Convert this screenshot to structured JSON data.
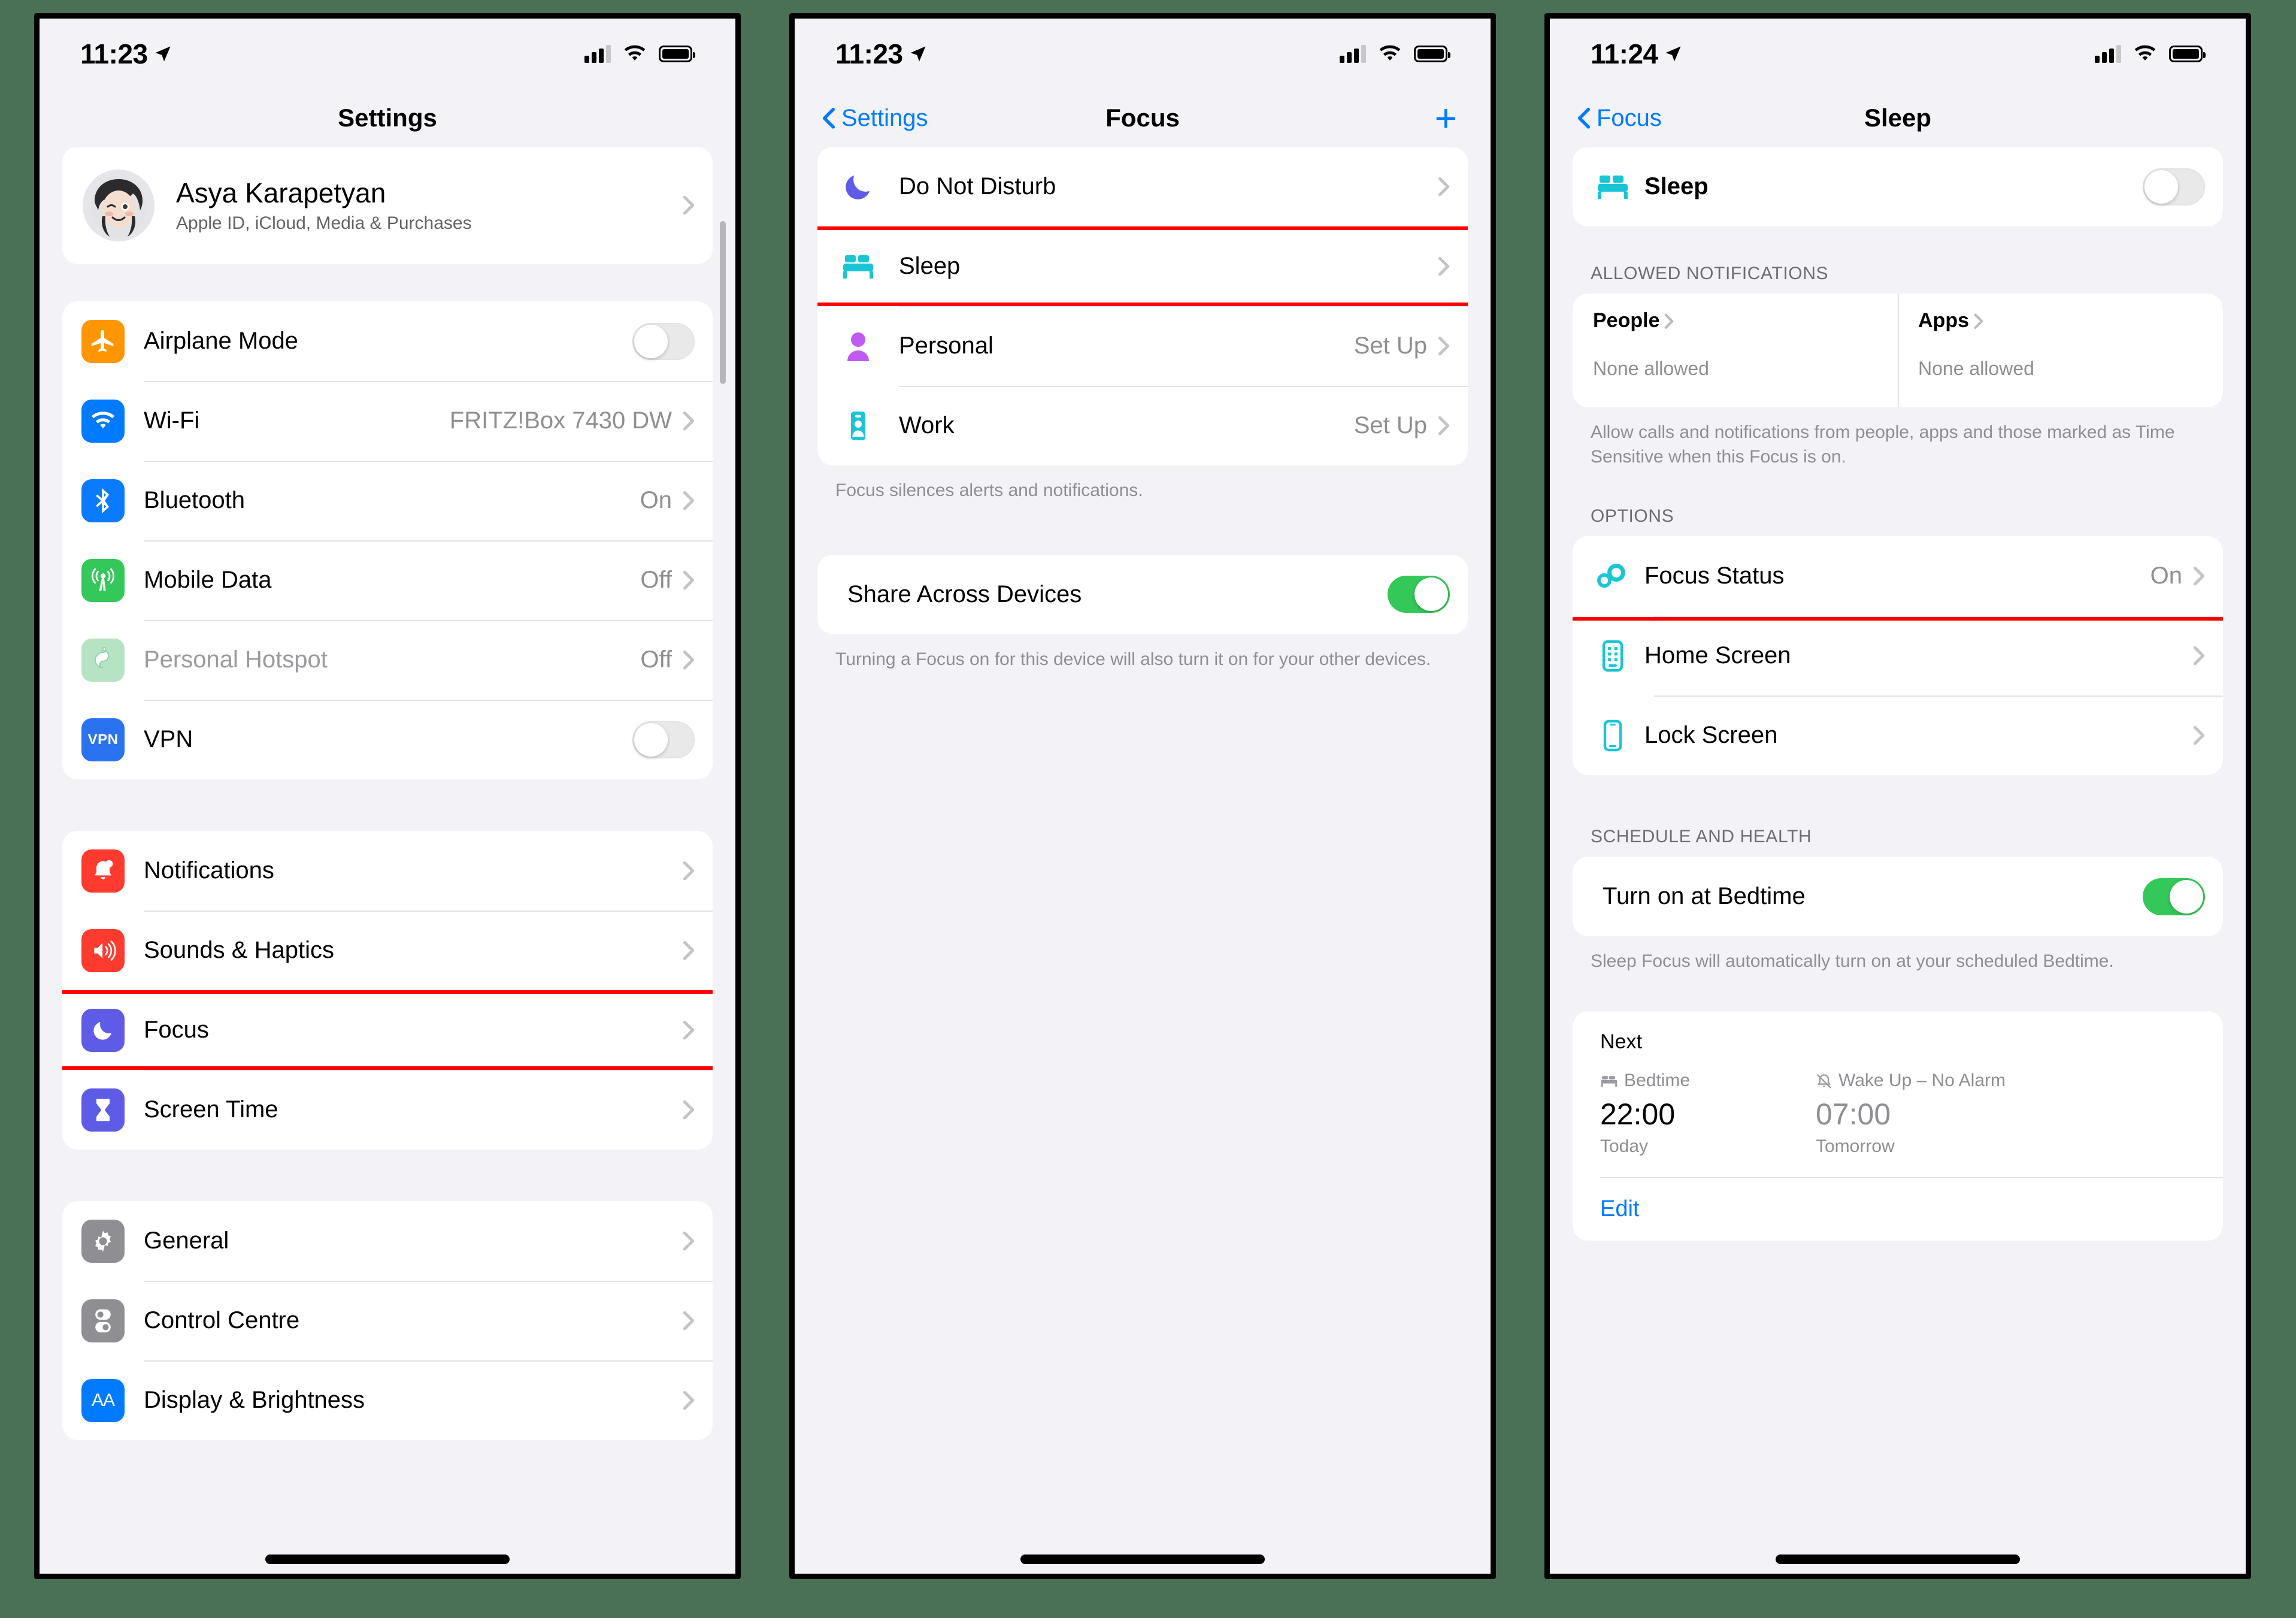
{
  "colors": {
    "canvas_background": "#4a7055",
    "accent_blue": "#007aff",
    "toggle_on_green": "#34c759",
    "highlight_red": "#ff0000",
    "screen_background": "#f2f2f7"
  },
  "screen1": {
    "status": {
      "time": "11:23"
    },
    "nav": {
      "title": "Settings"
    },
    "profile": {
      "name": "Asya Karapetyan",
      "subtitle": "Apple ID, iCloud, Media & Purchases"
    },
    "group_connectivity": [
      {
        "label": "Airplane Mode",
        "icon": "airplane-icon",
        "control": "toggle",
        "value": "off"
      },
      {
        "label": "Wi-Fi",
        "icon": "wifi-icon",
        "control": "value",
        "value": "FRITZ!Box 7430 DW"
      },
      {
        "label": "Bluetooth",
        "icon": "bluetooth-icon",
        "control": "value",
        "value": "On"
      },
      {
        "label": "Mobile Data",
        "icon": "mobile-data-icon",
        "control": "value",
        "value": "Off"
      },
      {
        "label": "Personal Hotspot",
        "icon": "hotspot-icon",
        "control": "value",
        "value": "Off",
        "dim": true
      },
      {
        "label": "VPN",
        "icon": "vpn-icon",
        "control": "toggle",
        "value": "off"
      }
    ],
    "group_alerts": [
      {
        "label": "Notifications",
        "icon": "bell-icon"
      },
      {
        "label": "Sounds & Haptics",
        "icon": "speaker-icon"
      },
      {
        "label": "Focus",
        "icon": "moon-icon",
        "highlighted": true
      },
      {
        "label": "Screen Time",
        "icon": "hourglass-icon"
      }
    ],
    "group_system": [
      {
        "label": "General",
        "icon": "gear-icon"
      },
      {
        "label": "Control Centre",
        "icon": "control-centre-icon"
      },
      {
        "label": "Display & Brightness",
        "icon": "display-brightness-icon"
      }
    ]
  },
  "screen2": {
    "status": {
      "time": "11:23"
    },
    "nav": {
      "back": "Settings",
      "title": "Focus",
      "add": "+"
    },
    "focus_modes": [
      {
        "label": "Do Not Disturb",
        "icon": "moon-icon",
        "value": ""
      },
      {
        "label": "Sleep",
        "icon": "bed-icon",
        "value": "",
        "highlighted": true
      },
      {
        "label": "Personal",
        "icon": "person-icon",
        "value": "Set Up"
      },
      {
        "label": "Work",
        "icon": "briefcase-icon",
        "value": "Set Up"
      }
    ],
    "footer_modes": "Focus silences alerts and notifications.",
    "share": {
      "label": "Share Across Devices",
      "value": "on"
    },
    "footer_share": "Turning a Focus on for this device will also turn it on for your other devices."
  },
  "screen3": {
    "status": {
      "time": "11:24"
    },
    "nav": {
      "back": "Focus",
      "title": "Sleep"
    },
    "sleep_toggle": {
      "label": "Sleep",
      "icon": "bed-icon",
      "value": "off"
    },
    "allowed": {
      "header": "ALLOWED NOTIFICATIONS",
      "columns": [
        {
          "title": "People",
          "value": "None allowed"
        },
        {
          "title": "Apps",
          "value": "None allowed"
        }
      ],
      "footer": "Allow calls and notifications from people, apps and those marked as Time Sensitive when this Focus is on."
    },
    "options": {
      "header": "OPTIONS",
      "items": [
        {
          "label": "Focus Status",
          "icon": "focus-status-icon",
          "value": "On",
          "highlighted": true
        },
        {
          "label": "Home Screen",
          "icon": "home-screen-icon",
          "value": ""
        },
        {
          "label": "Lock Screen",
          "icon": "lock-screen-icon",
          "value": ""
        }
      ]
    },
    "schedule": {
      "header": "SCHEDULE AND HEALTH",
      "bedtime_toggle": {
        "label": "Turn on at Bedtime",
        "value": "on"
      },
      "footer": "Sleep Focus will automatically turn on at your scheduled Bedtime.",
      "next_title": "Next",
      "bedtime": {
        "label": "Bedtime",
        "time": "22:00",
        "day": "Today"
      },
      "wake": {
        "label": "Wake Up – No Alarm",
        "time": "07:00",
        "day": "Tomorrow"
      },
      "edit": "Edit"
    }
  }
}
